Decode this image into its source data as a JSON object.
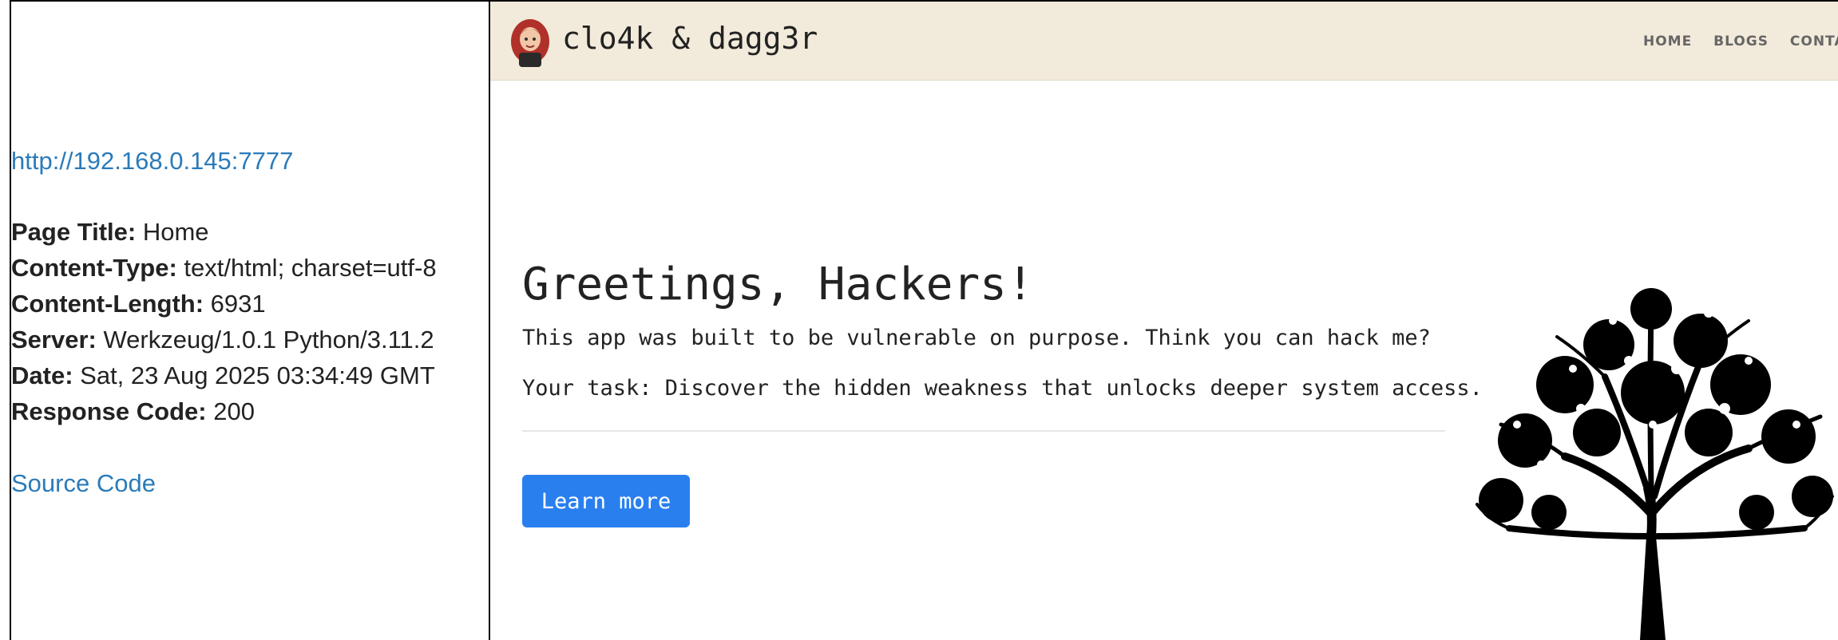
{
  "info_panel": {
    "url": "http://192.168.0.145:7777",
    "fields": [
      {
        "label": "Page Title:",
        "value": "Home"
      },
      {
        "label": "Content-Type:",
        "value": "text/html; charset=utf-8"
      },
      {
        "label": "Content-Length:",
        "value": "6931"
      },
      {
        "label": "Server:",
        "value": "Werkzeug/1.0.1 Python/3.11.2"
      },
      {
        "label": "Date:",
        "value": "Sat, 23 Aug 2025 03:34:49 GMT"
      },
      {
        "label": "Response Code:",
        "value": "200"
      }
    ],
    "source_link": "Source Code"
  },
  "site": {
    "brand": {
      "name": "clo4k & dagg3r",
      "avatar_icon": "avatar-icon"
    },
    "nav": {
      "items": [
        "HOME",
        "BLOGS",
        "CONTACT"
      ]
    },
    "hero": {
      "title": "Greetings, Hackers!",
      "line1": "This app was built to be vulnerable on purpose. Think you can hack me?",
      "line2": "Your task: Discover the hidden weakness that unlocks deeper system access.",
      "button": "Learn more"
    },
    "colors": {
      "navbar_bg": "#f2eada",
      "button_bg": "#2a7fef",
      "link": "#2b7bb9"
    },
    "decor_icon": "tree-icon"
  }
}
